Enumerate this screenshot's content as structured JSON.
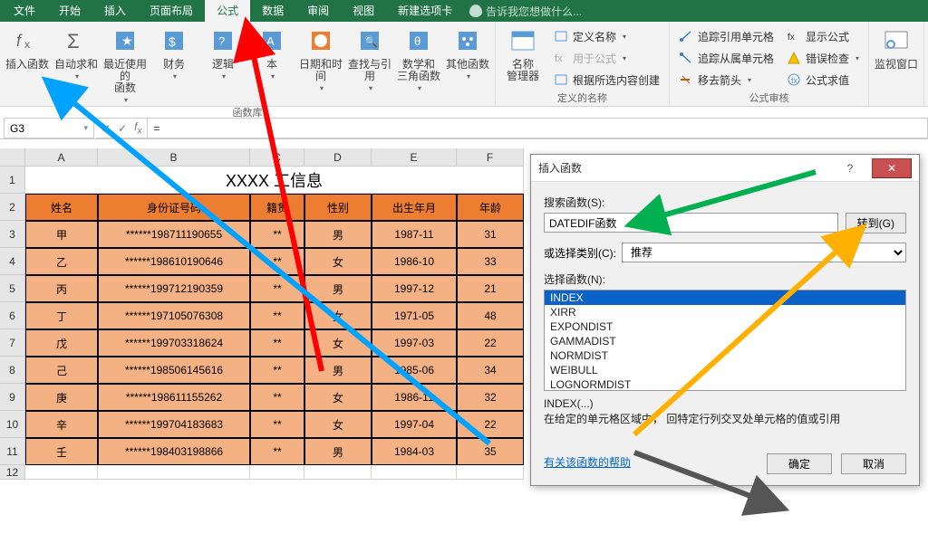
{
  "menu": {
    "items": [
      "文件",
      "开始",
      "插入",
      "页面布局",
      "公式",
      "数据",
      "审阅",
      "视图",
      "新建选项卡"
    ],
    "active": 4,
    "tell": "告诉我您想做什么..."
  },
  "ribbon": {
    "g1": [
      {
        "l1": "插入函数"
      },
      {
        "l1": "自动求和"
      },
      {
        "l1": "最近使用的",
        "l2": "函数"
      },
      {
        "l1": "财务"
      },
      {
        "l1": "逻辑"
      },
      {
        "l1": "本"
      },
      {
        "l1": "日期和时间"
      },
      {
        "l1": "查找与引用"
      },
      {
        "l1": "数学和",
        "l2": "三角函数"
      },
      {
        "l1": "其他函数"
      }
    ],
    "g1label": "函数库",
    "g2big": {
      "l1": "名称",
      "l2": "管理器"
    },
    "g2rows": [
      "定义名称",
      "用于公式",
      "根据所选内容创建"
    ],
    "g2label": "定义的名称",
    "g3rows": [
      "追踪引用单元格",
      "追踪从属单元格",
      "移去箭头"
    ],
    "g3r": [
      "显示公式",
      "错误检查",
      "公式求值"
    ],
    "g3label": "公式审核",
    "g4": {
      "l1": "监视窗口"
    }
  },
  "namebox": "G3",
  "fxval": "=",
  "sheet": {
    "cols": [
      "A",
      "B",
      "C",
      "D",
      "E",
      "F"
    ],
    "title": "XXXX    工信息",
    "headers": [
      "姓名",
      "身份证号码",
      "籍贯",
      "性别",
      "出生年月",
      "年龄"
    ],
    "rows": [
      [
        "甲",
        "******198711190655",
        "**",
        "男",
        "1987-11",
        "31"
      ],
      [
        "乙",
        "******198610190646",
        "**",
        "女",
        "1986-10",
        "33"
      ],
      [
        "丙",
        "******199712190359",
        "**",
        "男",
        "1997-12",
        "21"
      ],
      [
        "丁",
        "******197105076308",
        "**",
        "女",
        "1971-05",
        "48"
      ],
      [
        "戊",
        "******199703318624",
        "**",
        "女",
        "1997-03",
        "22"
      ],
      [
        "己",
        "******198506145616",
        "**",
        "男",
        "1985-06",
        "34"
      ],
      [
        "庚",
        "******198611155262",
        "**",
        "女",
        "1986-11",
        "32"
      ],
      [
        "辛",
        "******199704183683",
        "**",
        "女",
        "1997-04",
        "22"
      ],
      [
        "壬",
        "******198403198866",
        "**",
        "男",
        "1984-03",
        "35"
      ]
    ]
  },
  "dialog": {
    "title": "插入函数",
    "searchLabel": "搜索函数(S):",
    "searchVal": "DATEDIF函数",
    "goBtn": "转到(G)",
    "catLabel": "或选择类别(C):",
    "catVal": "推荐",
    "selLabel": "选择函数(N):",
    "funcs": [
      "INDEX",
      "XIRR",
      "EXPONDIST",
      "GAMMADIST",
      "NORMDIST",
      "WEIBULL",
      "LOGNORMDIST"
    ],
    "descTitle": "INDEX(...)",
    "descBody": "在给定的单元格区域中，   回特定行列交叉处单元格的值或引用",
    "help": "有关该函数的帮助",
    "ok": "确定",
    "cancel": "取消"
  },
  "chart_data": {
    "type": "table",
    "title": "XXXX员工信息",
    "columns": [
      "姓名",
      "身份证号码",
      "籍贯",
      "性别",
      "出生年月",
      "年龄"
    ],
    "rows": [
      [
        "甲",
        "******198711190655",
        "**",
        "男",
        "1987-11",
        31
      ],
      [
        "乙",
        "******198610190646",
        "**",
        "女",
        "1986-10",
        33
      ],
      [
        "丙",
        "******199712190359",
        "**",
        "男",
        "1997-12",
        21
      ],
      [
        "丁",
        "******197105076308",
        "**",
        "女",
        "1971-05",
        48
      ],
      [
        "戊",
        "******199703318624",
        "**",
        "女",
        "1997-03",
        22
      ],
      [
        "己",
        "******198506145616",
        "**",
        "男",
        "1985-06",
        34
      ],
      [
        "庚",
        "******198611155262",
        "**",
        "女",
        "1986-11",
        32
      ],
      [
        "辛",
        "******199704183683",
        "**",
        "女",
        "1997-04",
        22
      ],
      [
        "壬",
        "******198403198866",
        "**",
        "男",
        "1984-03",
        35
      ]
    ]
  }
}
